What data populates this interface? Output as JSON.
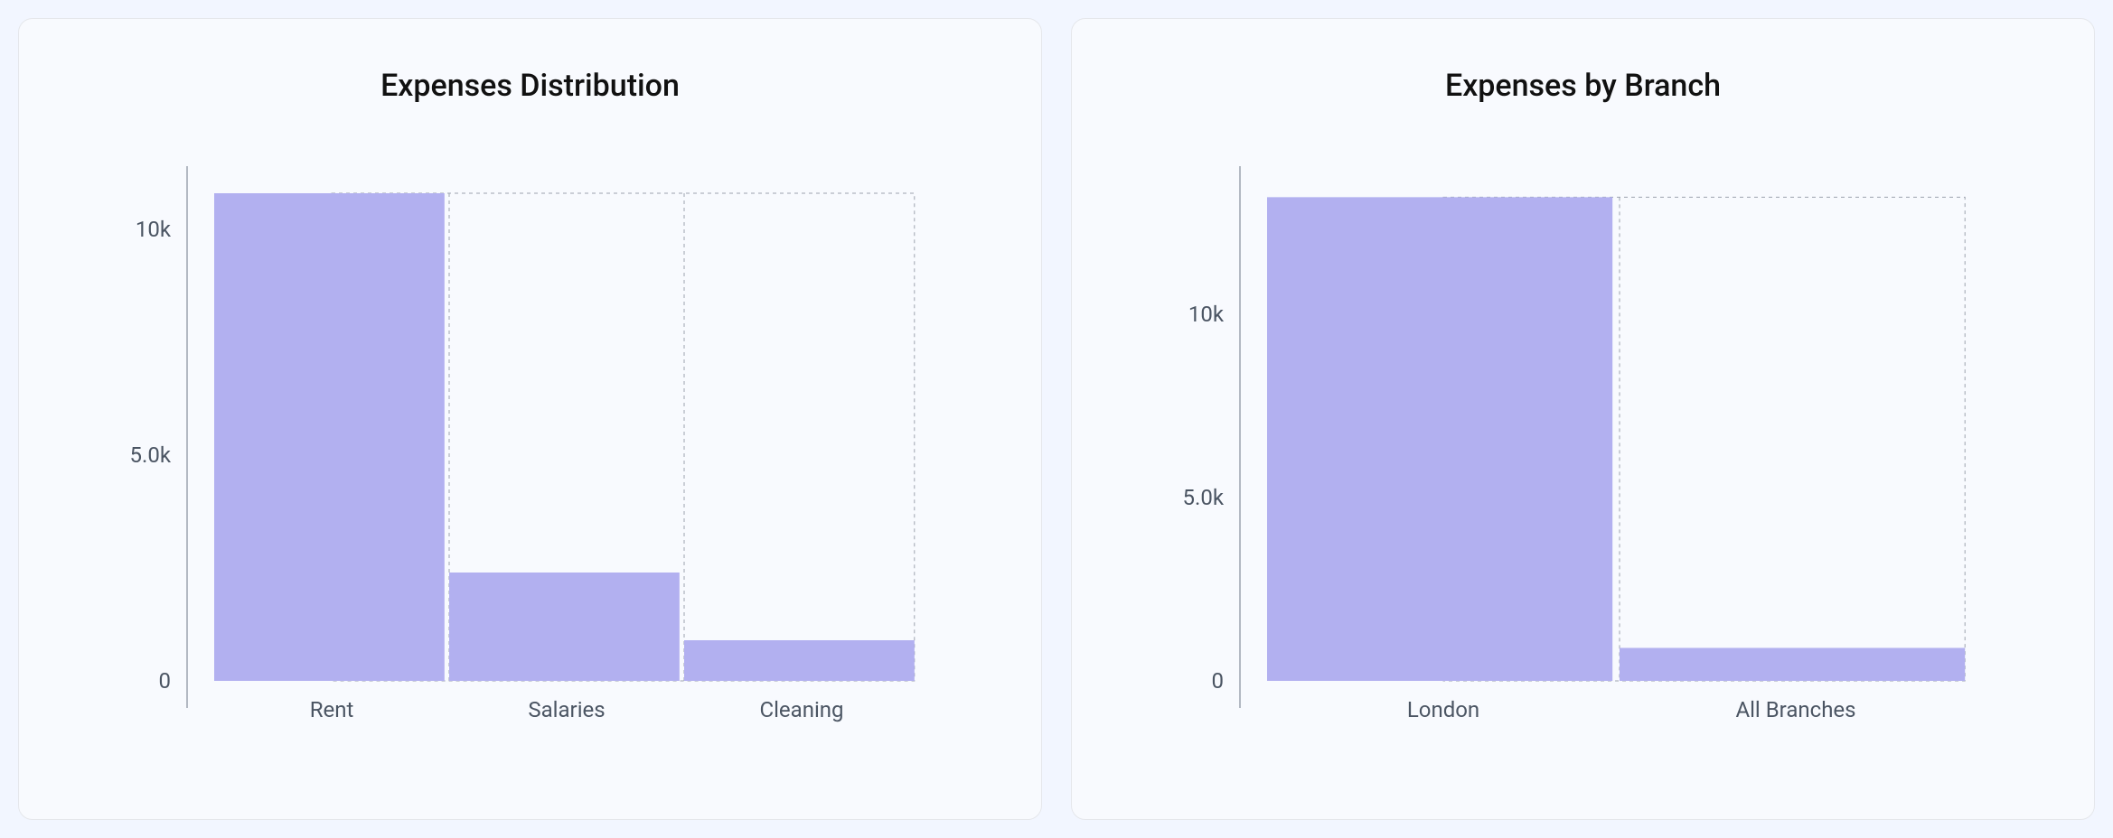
{
  "chart_data": [
    {
      "id": "distribution",
      "type": "bar",
      "title": "Expenses Distribution",
      "categories": [
        "Rent",
        "Salaries",
        "Cleaning"
      ],
      "values": [
        10800,
        2400,
        900
      ],
      "ylim": [
        0,
        11200
      ],
      "yticks": [
        0,
        5000,
        10000
      ],
      "ytick_labels": [
        "0",
        "5.0k",
        "10k"
      ]
    },
    {
      "id": "branch",
      "type": "bar",
      "title": "Expenses by Branch",
      "categories": [
        "London",
        "All Branches"
      ],
      "values": [
        13200,
        900
      ],
      "ylim": [
        0,
        13800
      ],
      "yticks": [
        0,
        5000,
        10000
      ],
      "ytick_labels": [
        "0",
        "5.0k",
        "10k"
      ]
    }
  ]
}
